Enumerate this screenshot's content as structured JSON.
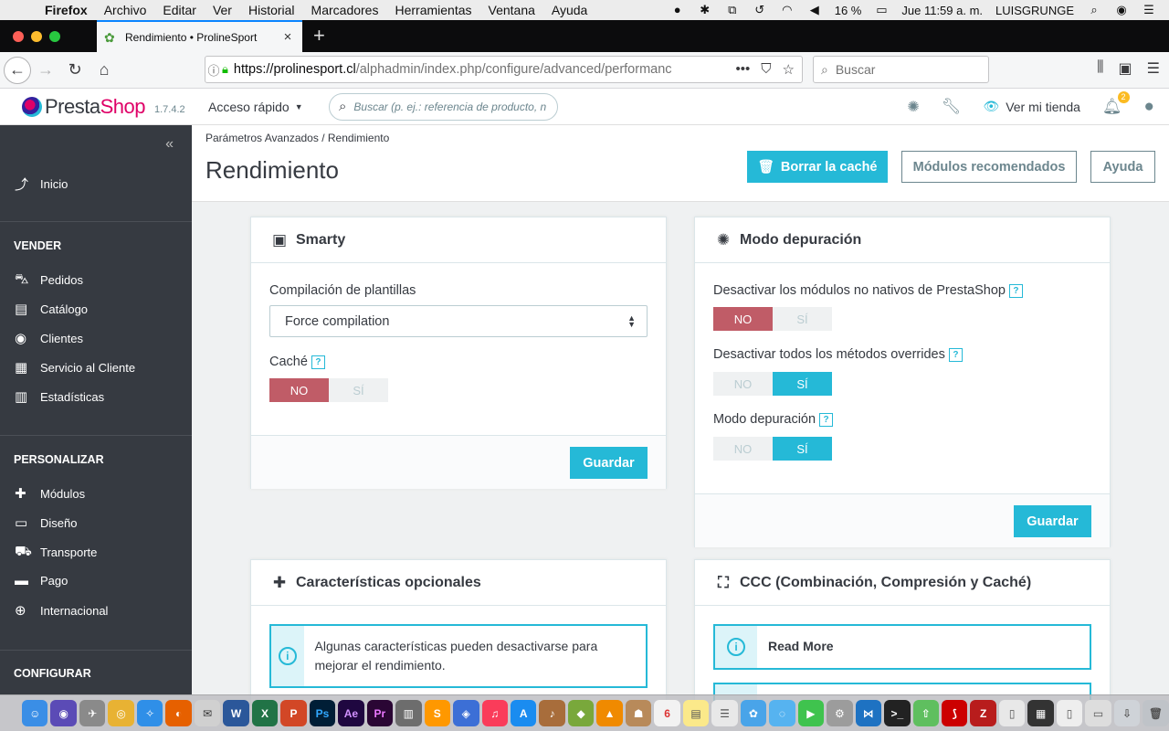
{
  "menubar": {
    "items": [
      "Firefox",
      "Archivo",
      "Editar",
      "Ver",
      "Historial",
      "Marcadores",
      "Herramientas",
      "Ventana",
      "Ayuda"
    ],
    "battery": "16 %",
    "clock": "Jue 11:59 a. m.",
    "user": "LUISGRUNGE"
  },
  "browser": {
    "tab_title": "Rendimiento • ProlineSport",
    "url_host": "https://prolinesport.cl",
    "url_path": "/alphadmin/index.php/configure/advanced/performanc",
    "search_placeholder": "Buscar"
  },
  "ps_header": {
    "logo_presta": "Presta",
    "logo_shop": "Shop",
    "version": "1.7.4.2",
    "quick_access": "Acceso rápido",
    "search_placeholder": "Buscar (p. ej.: referencia de producto, n",
    "view_store": "Ver mi tienda",
    "notif_count": "2"
  },
  "sidebar": {
    "home": "Inicio",
    "sections": [
      {
        "title": "VENDER",
        "items": [
          "Pedidos",
          "Catálogo",
          "Clientes",
          "Servicio al Cliente",
          "Estadísticas"
        ]
      },
      {
        "title": "PERSONALIZAR",
        "items": [
          "Módulos",
          "Diseño",
          "Transporte",
          "Pago",
          "Internacional"
        ]
      },
      {
        "title": "CONFIGURAR",
        "items": []
      }
    ]
  },
  "page": {
    "breadcrumb_parent": "Parámetros Avanzados",
    "breadcrumb_current": "Rendimiento",
    "title": "Rendimiento",
    "btn_clear_cache": "Borrar la caché",
    "btn_modules": "Módulos recomendados",
    "btn_help": "Ayuda"
  },
  "smarty": {
    "title": "Smarty",
    "compile_label": "Compilación de plantillas",
    "compile_value": "Force compilation",
    "cache_label": "Caché",
    "no": "NO",
    "yes": "SÍ",
    "cache_value": "NO",
    "save": "Guardar"
  },
  "debug": {
    "title": "Modo depuración",
    "disable_modules_label": "Desactivar los módulos no nativos de PrestaShop",
    "disable_modules_value": "NO",
    "disable_overrides_label": "Desactivar todos los métodos overrides",
    "disable_overrides_value": "SÍ",
    "debug_mode_label": "Modo depuración",
    "debug_mode_value": "SÍ",
    "no": "NO",
    "yes": "SÍ",
    "save": "Guardar"
  },
  "optional": {
    "title": "Características opcionales",
    "alert": "Algunas características pueden desactivarse para mejorar el rendimiento."
  },
  "ccc": {
    "title": "CCC (Combinación, Compresión y Caché)",
    "read_more": "Read More"
  },
  "colors": {
    "accent": "#25b9d7",
    "no_active": "#c05c67",
    "sidebar_bg": "#363a41"
  }
}
